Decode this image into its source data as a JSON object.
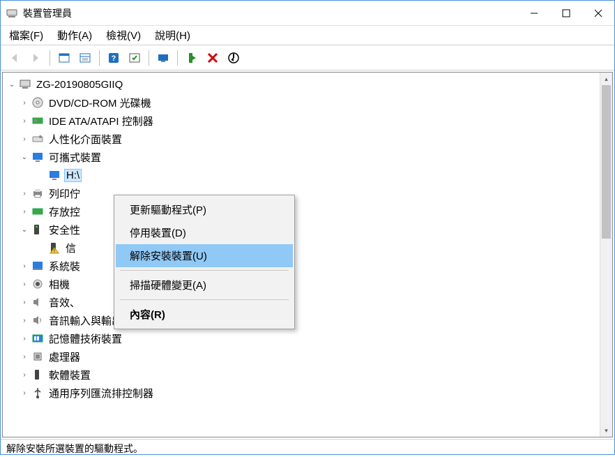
{
  "window": {
    "title": "裝置管理員"
  },
  "menu": {
    "file": "檔案(F)",
    "action": "動作(A)",
    "view": "檢視(V)",
    "help": "說明(H)"
  },
  "tree": {
    "root": "ZG-20190805GIIQ",
    "dvd": "DVD/CD-ROM 光碟機",
    "ide": "IDE ATA/ATAPI 控制器",
    "hid": "人性化介面裝置",
    "portable": "可攜式裝置",
    "portable_h": "H:\\",
    "printer": "列印佇",
    "storage": "存放控",
    "security": "安全性",
    "trust": "信",
    "system": "系統裝",
    "camera": "相機",
    "audio": "音效、",
    "audio_io": "音訊輸入與輸出",
    "memory": "記憶體技術裝置",
    "cpu": "處理器",
    "software": "軟體裝置",
    "usb": "通用序列匯流排控制器"
  },
  "context_menu": {
    "update": "更新驅動程式(P)",
    "disable": "停用裝置(D)",
    "uninstall": "解除安裝裝置(U)",
    "scan": "掃描硬體變更(A)",
    "properties": "內容(R)"
  },
  "status": "解除安裝所選裝置的驅動程式。"
}
